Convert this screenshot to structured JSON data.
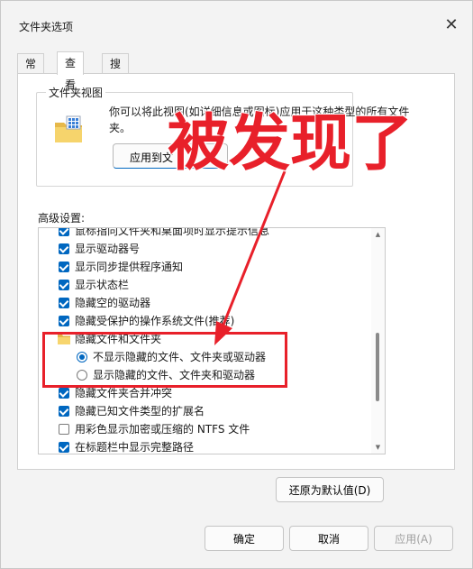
{
  "window": {
    "title": "文件夹选项",
    "close_glyph": "✕"
  },
  "tabs": [
    {
      "label": "常规",
      "active": false
    },
    {
      "label": "查看",
      "active": true
    },
    {
      "label": "搜索",
      "active": false
    }
  ],
  "folder_views": {
    "label": "文件夹视图",
    "description": "你可以将此视图(如详细信息或图标)应用于这种类型的所有文件夹。",
    "apply_button": "应用到文"
  },
  "advanced": {
    "label": "高级设置:",
    "items": [
      {
        "kind": "checkbox",
        "checked": true,
        "label": "鼠标指向文件夹和桌面项时显示提示信息"
      },
      {
        "kind": "checkbox",
        "checked": true,
        "label": "显示驱动器号"
      },
      {
        "kind": "checkbox",
        "checked": true,
        "label": "显示同步提供程序通知"
      },
      {
        "kind": "checkbox",
        "checked": true,
        "label": "显示状态栏"
      },
      {
        "kind": "checkbox",
        "checked": true,
        "label": "隐藏空的驱动器"
      },
      {
        "kind": "checkbox",
        "checked": true,
        "label": "隐藏受保护的操作系统文件(推荐)"
      },
      {
        "kind": "folder",
        "label": "隐藏文件和文件夹"
      },
      {
        "kind": "radio",
        "selected": true,
        "label": "不显示隐藏的文件、文件夹或驱动器"
      },
      {
        "kind": "radio",
        "selected": false,
        "label": "显示隐藏的文件、文件夹和驱动器"
      },
      {
        "kind": "checkbox",
        "checked": true,
        "label": "隐藏文件夹合并冲突"
      },
      {
        "kind": "checkbox",
        "checked": true,
        "label": "隐藏已知文件类型的扩展名"
      },
      {
        "kind": "checkbox",
        "checked": false,
        "label": "用彩色显示加密或压缩的 NTFS 文件"
      },
      {
        "kind": "checkbox",
        "checked": true,
        "label": "在标题栏中显示完整路径"
      }
    ],
    "scroll_offset_rows": 0.35,
    "scroll_thumb": {
      "start_fraction": 0.46,
      "size_fraction": 0.34
    }
  },
  "buttons": {
    "restore_defaults": "还原为默认值(D)",
    "ok": "确定",
    "cancel": "取消",
    "apply": "应用(A)"
  },
  "annotation": {
    "text": "被发现了",
    "color": "#e8202a"
  },
  "colors": {
    "accent": "#0067c0",
    "annotation_red": "#e8202a"
  }
}
